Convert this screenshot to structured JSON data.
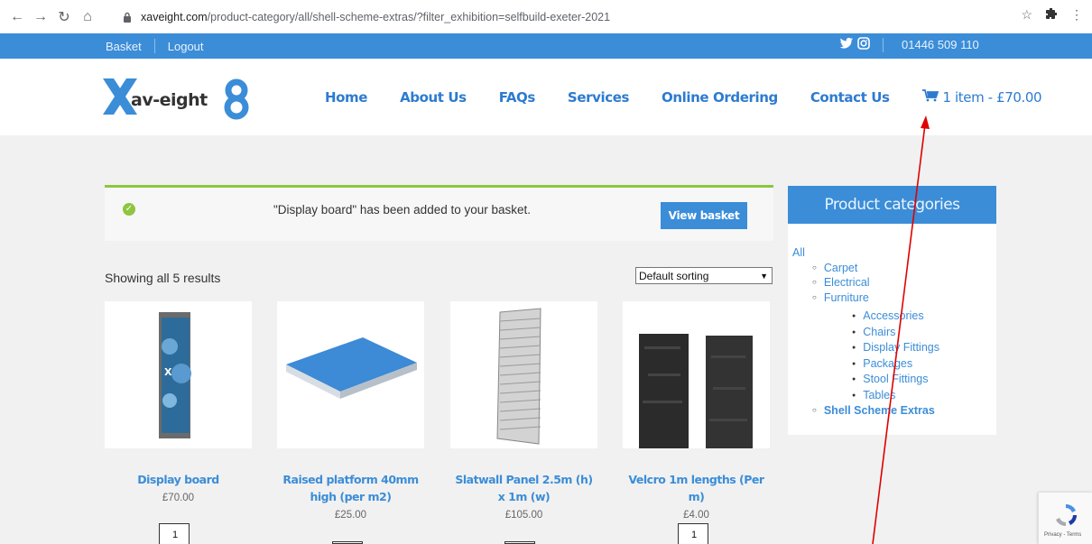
{
  "browser": {
    "url_host": "xaveight.com",
    "url_path": "/product-category/all/shell-scheme-extras/?filter_exhibition=selfbuild-exeter-2021"
  },
  "topbar": {
    "basket": "Basket",
    "logout": "Logout",
    "phone": "01446 509 110"
  },
  "header": {
    "logo_text": "av-eight",
    "nav": [
      "Home",
      "About Us",
      "FAQs",
      "Services",
      "Online Ordering",
      "Contact Us"
    ],
    "cart": "1 item - £70.00"
  },
  "notice": {
    "message": "\"Display board\" has been added to your basket.",
    "button": "View basket"
  },
  "results": {
    "count": "Showing all 5 results",
    "sorting": "Default sorting"
  },
  "products": [
    {
      "name": "Display board",
      "price": "£70.00",
      "qty": "1"
    },
    {
      "name": "Raised platform 40mm high (per m2)",
      "price": "£25.00",
      "qty": ""
    },
    {
      "name": "Slatwall Panel 2.5m (h) x 1m (w)",
      "price": "£105.00",
      "qty": ""
    },
    {
      "name": "Velcro 1m lengths (Per m)",
      "price": "£4.00",
      "qty": "1"
    }
  ],
  "sidebar": {
    "title": "Product categories",
    "all": "All",
    "top": [
      "Carpet",
      "Electrical",
      "Furniture"
    ],
    "furniture": [
      "Accessories",
      "Chairs",
      "Display Fittings",
      "Packages",
      "Stool Fittings",
      "Tables"
    ],
    "current": "Shell Scheme Extras"
  },
  "recaptcha": {
    "text": "Privacy - Terms"
  },
  "colors": {
    "brand_blue": "#3b8dd8",
    "success_green": "#8dc63f",
    "annotation_red": "#e00000"
  }
}
